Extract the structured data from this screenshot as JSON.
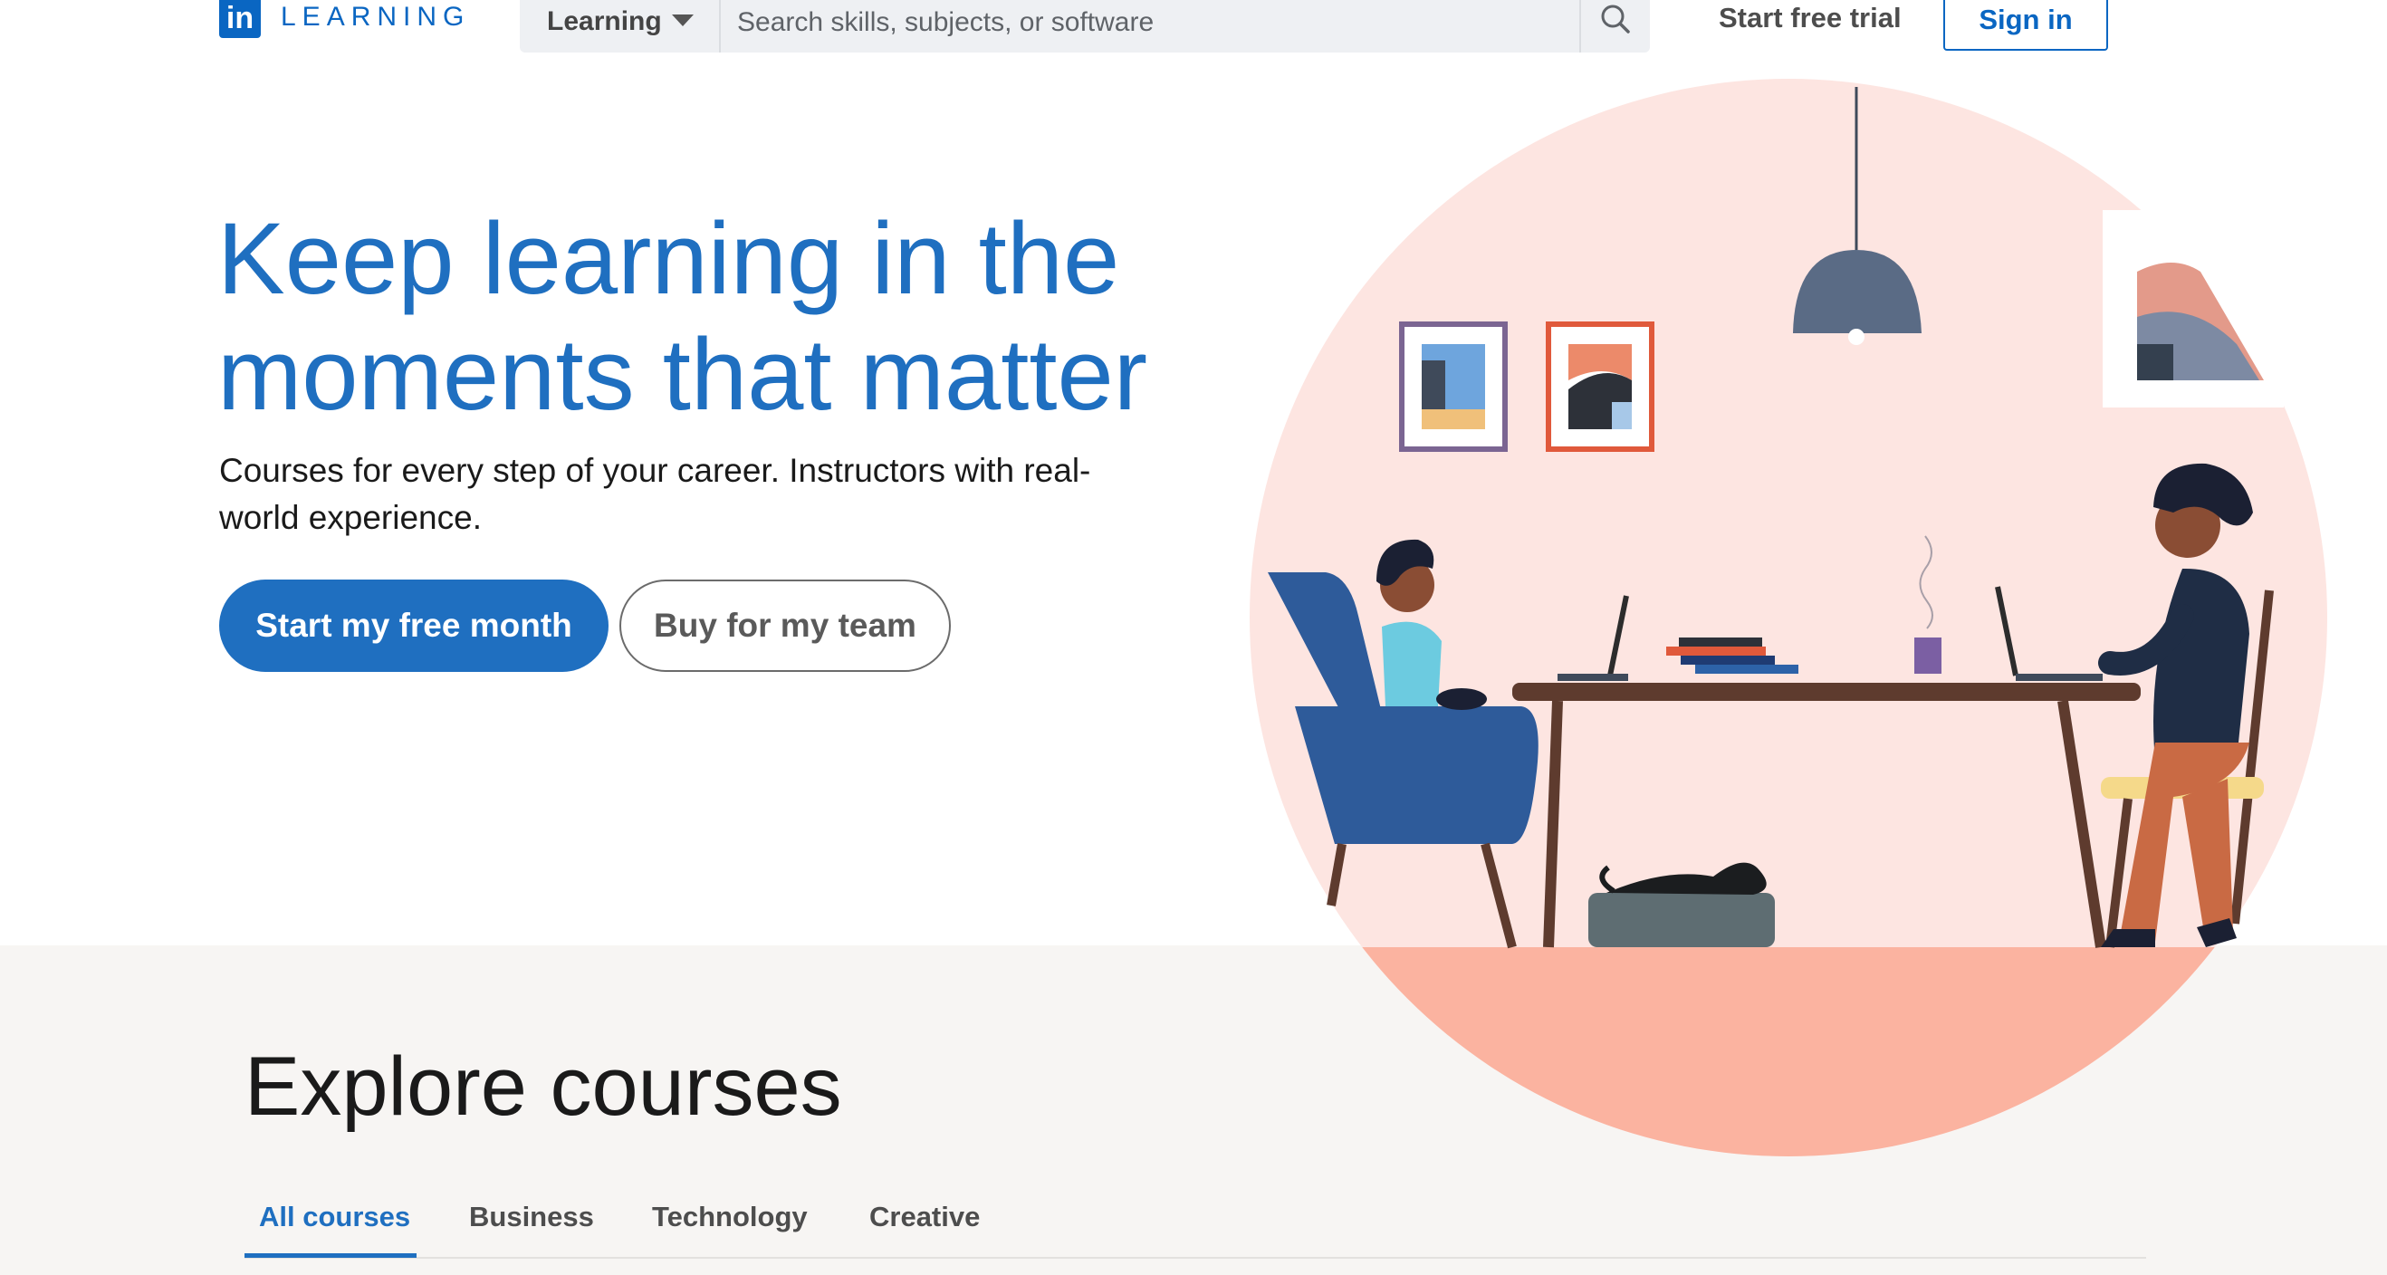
{
  "header": {
    "logo_mark": "in",
    "logo_word": "LEARNING",
    "category_label": "Learning",
    "search_placeholder": "Search skills, subjects, or software",
    "start_trial_label": "Start free trial",
    "sign_in_label": "Sign in"
  },
  "hero": {
    "title_line1": "Keep learning in the",
    "title_line2": "moments that matter",
    "subtitle_line1": "Courses for every step of your career. Instructors with real-",
    "subtitle_line2": "world experience.",
    "primary_cta": "Start my free month",
    "secondary_cta": "Buy for my team"
  },
  "explore": {
    "title": "Explore courses",
    "tabs": [
      {
        "label": "All courses",
        "active": true
      },
      {
        "label": "Business",
        "active": false
      },
      {
        "label": "Technology",
        "active": false
      },
      {
        "label": "Creative",
        "active": false
      }
    ]
  },
  "icons": {
    "search": "search-icon",
    "caret": "caret-down-icon"
  },
  "colors": {
    "brand_blue": "#0a66c2",
    "headline_blue": "#1f6fc0",
    "illustration_bg": "#fde5e1",
    "floor": "#fbb3a0"
  }
}
